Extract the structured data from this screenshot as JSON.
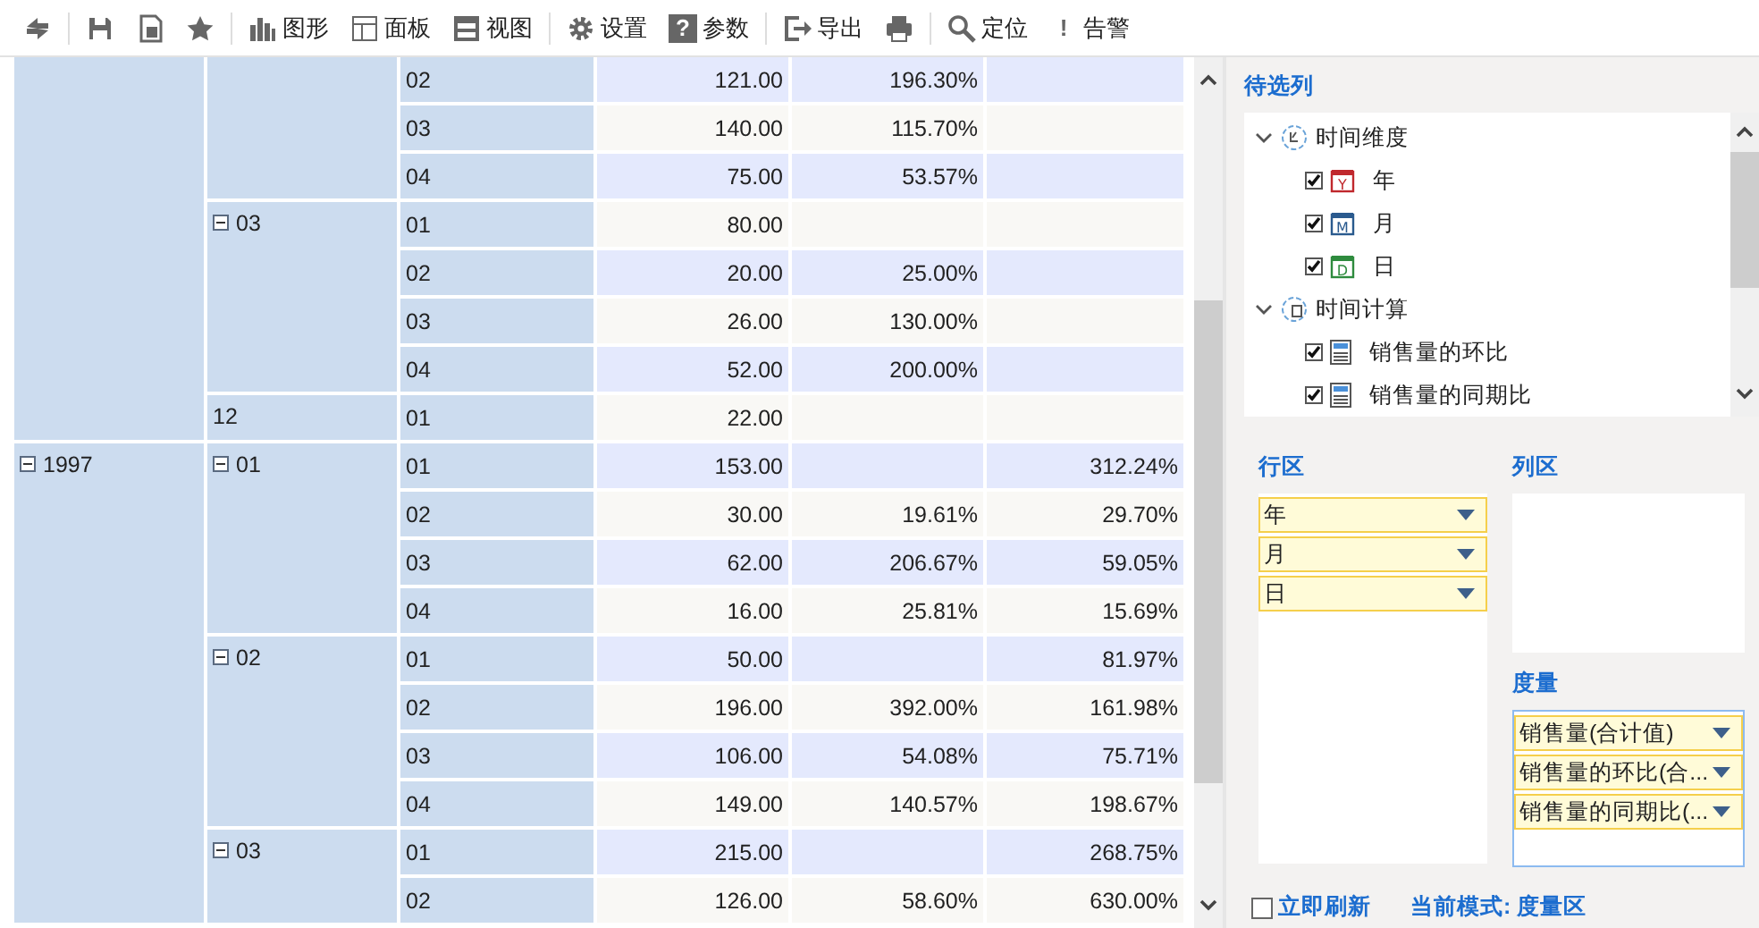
{
  "toolbar": {
    "buttons": [
      {
        "label": "图形"
      },
      {
        "label": "面板"
      },
      {
        "label": "视图"
      },
      {
        "label": "设置"
      },
      {
        "glyph": "?",
        "label": "参数"
      },
      {
        "label": "导出"
      },
      {
        "label": "定位"
      },
      {
        "glyph": "!",
        "label": "告警"
      }
    ]
  },
  "pivot": {
    "years": [
      {
        "months": [
          {
            "days": [
              {
                "day": "02",
                "value": "121.00",
                "ring_ratio": "196.30%"
              },
              {
                "day": "03",
                "value": "140.00",
                "ring_ratio": "115.70%"
              },
              {
                "day": "04",
                "value": "75.00",
                "ring_ratio": "53.57%"
              }
            ]
          },
          {
            "label": "03",
            "expanded": true,
            "days": [
              {
                "day": "01",
                "value": "80.00"
              },
              {
                "day": "02",
                "value": "20.00",
                "ring_ratio": "25.00%"
              },
              {
                "day": "03",
                "value": "26.00",
                "ring_ratio": "130.00%"
              },
              {
                "day": "04",
                "value": "52.00",
                "ring_ratio": "200.00%"
              }
            ]
          },
          {
            "label": "12",
            "days": [
              {
                "day": "01",
                "value": "22.00"
              }
            ]
          }
        ]
      },
      {
        "label": "1997",
        "expanded": true,
        "months": [
          {
            "label": "01",
            "expanded": true,
            "days": [
              {
                "day": "01",
                "value": "153.00",
                "yoy": "312.24%"
              },
              {
                "day": "02",
                "value": "30.00",
                "ring_ratio": "19.61%",
                "yoy": "29.70%"
              },
              {
                "day": "03",
                "value": "62.00",
                "ring_ratio": "206.67%",
                "yoy": "59.05%"
              },
              {
                "day": "04",
                "value": "16.00",
                "ring_ratio": "25.81%",
                "yoy": "15.69%"
              }
            ]
          },
          {
            "label": "02",
            "expanded": true,
            "days": [
              {
                "day": "01",
                "value": "50.00",
                "yoy": "81.97%"
              },
              {
                "day": "02",
                "value": "196.00",
                "ring_ratio": "392.00%",
                "yoy": "161.98%"
              },
              {
                "day": "03",
                "value": "106.00",
                "ring_ratio": "54.08%",
                "yoy": "75.71%"
              },
              {
                "day": "04",
                "value": "149.00",
                "ring_ratio": "140.57%",
                "yoy": "198.67%"
              }
            ]
          },
          {
            "label": "03",
            "expanded": true,
            "days": [
              {
                "day": "01",
                "value": "215.00",
                "yoy": "268.75%"
              },
              {
                "day": "02",
                "value": "126.00",
                "ring_ratio": "58.60%",
                "yoy": "630.00%"
              }
            ]
          }
        ]
      }
    ]
  },
  "panel": {
    "candidates": {
      "title": "待选列",
      "tree": [
        {
          "label": "时间维度",
          "kind": "dimension",
          "expanded": true,
          "children": [
            {
              "label": "年",
              "kind": "calendar",
              "badge": "Y",
              "color": "#c0282d",
              "checked": true
            },
            {
              "label": "月",
              "kind": "calendar",
              "badge": "M",
              "color": "#2a5a8e",
              "checked": true
            },
            {
              "label": "日",
              "kind": "calendar",
              "badge": "D",
              "color": "#2e8b3e",
              "checked": true
            }
          ]
        },
        {
          "label": "时间计算",
          "kind": "calc",
          "expanded": true,
          "children": [
            {
              "label": "销售量的环比",
              "kind": "measure",
              "checked": true
            },
            {
              "label": "销售量的同期比",
              "kind": "measure",
              "checked": true
            }
          ]
        }
      ]
    },
    "row_zone": {
      "title": "行区",
      "items": [
        "年",
        "月",
        "日"
      ]
    },
    "column_zone": {
      "title": "列区"
    },
    "measure_zone": {
      "title": "度量",
      "items": [
        "销售量(合计值)",
        "销售量的环比(合...",
        "销售量的同期比(..."
      ]
    },
    "auto_refresh": {
      "label": "立即刷新",
      "checked": false
    },
    "mode": "当前模式: 度量区"
  }
}
